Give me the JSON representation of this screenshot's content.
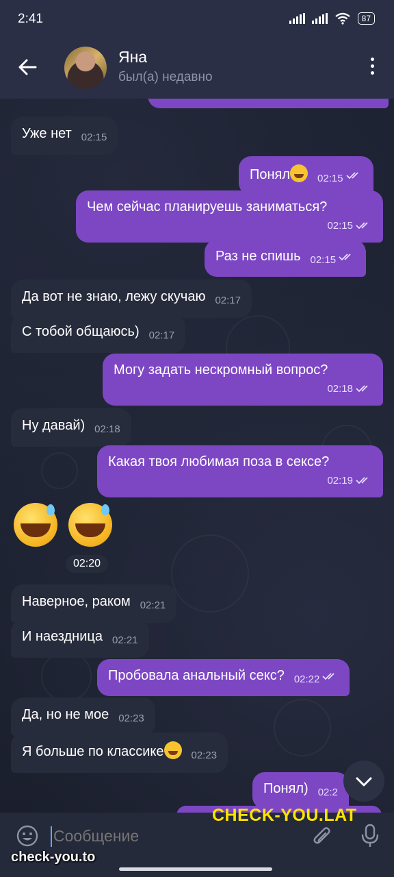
{
  "statusbar": {
    "time": "2:41",
    "battery": "87",
    "icons": [
      "signal-icon",
      "signal-icon",
      "wifi-icon",
      "battery-icon"
    ]
  },
  "header": {
    "name": "Яна",
    "status": "был(а) недавно"
  },
  "messages": [
    {
      "dir": "in",
      "text": "Уже нет",
      "time": "02:15"
    },
    {
      "dir": "out",
      "text": "Понял",
      "time": "02:15",
      "emoji": "grinning-sweat-emoji"
    },
    {
      "dir": "out",
      "text": "Чем сейчас планируешь заниматься?",
      "time": "02:15"
    },
    {
      "dir": "out",
      "text": "Раз не спишь",
      "time": "02:15"
    },
    {
      "dir": "in",
      "text": "Да вот не знаю, лежу скучаю",
      "time": "02:17"
    },
    {
      "dir": "in",
      "text": "С тобой общаюсь)",
      "time": "02:17"
    },
    {
      "dir": "out",
      "text": "Могу задать нескромный вопрос?",
      "time": "02:18"
    },
    {
      "dir": "in",
      "text": "Ну давай)",
      "time": "02:18"
    },
    {
      "dir": "out",
      "text": "Какая твоя любимая поза в сексе?",
      "time": "02:19"
    },
    {
      "dir": "in",
      "type": "emoji",
      "emoji": "grinning-sweat-emoji x2",
      "time": "02:20"
    },
    {
      "dir": "in",
      "text": "Наверное, раком",
      "time": "02:21"
    },
    {
      "dir": "in",
      "text": "И наездница",
      "time": "02:21"
    },
    {
      "dir": "out",
      "text": "Пробовала анальный секс?",
      "time": "02:22"
    },
    {
      "dir": "in",
      "text": "Да, но не мое",
      "time": "02:23"
    },
    {
      "dir": "in",
      "text": "Я больше по классике",
      "time": "02:23",
      "emoji": "grinning-sweat-emoji"
    },
    {
      "dir": "out",
      "text": "Понял)",
      "time": "02:2"
    }
  ],
  "input": {
    "placeholder": "Сообщение"
  },
  "watermarks": {
    "top": "CHECK-YOU.LAT",
    "bottom": "check-you.to"
  },
  "colors": {
    "background": "#1c2131",
    "header": "#2a2f45",
    "incoming_bubble": "#272c3c",
    "outgoing_bubble": "#7d47c4",
    "watermark_yellow": "#ffe400"
  }
}
